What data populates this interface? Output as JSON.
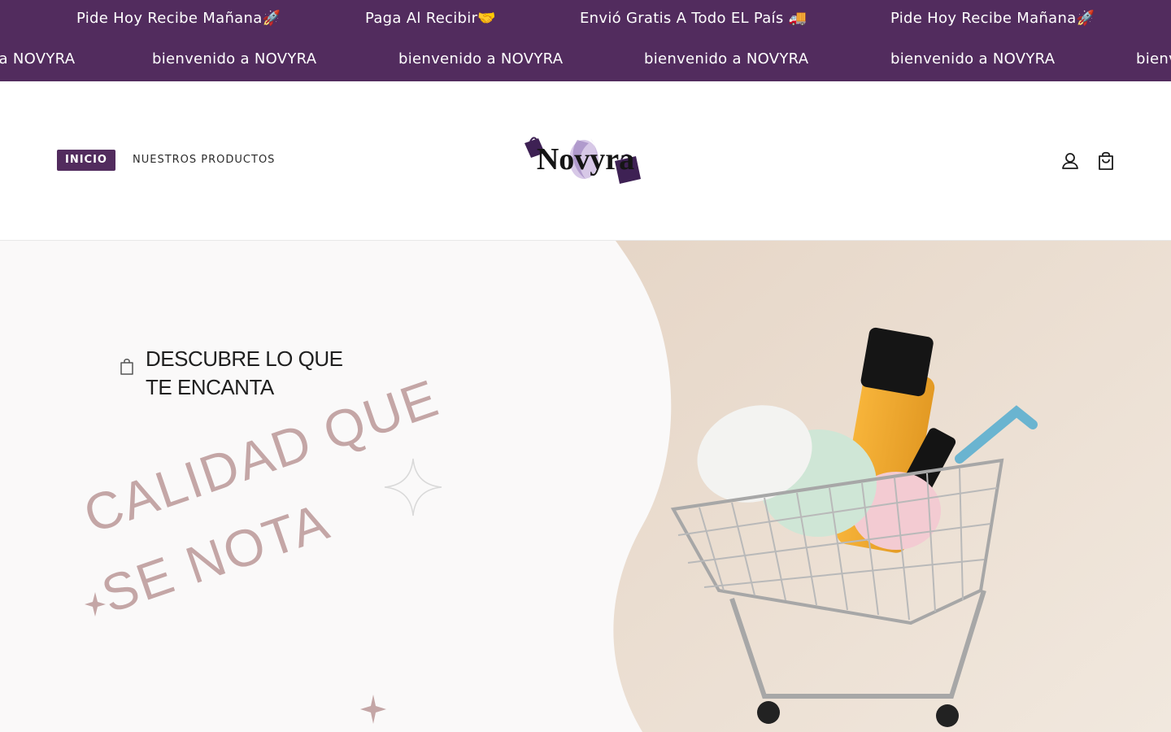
{
  "announcement_bar": {
    "row1": [
      "Pide Hoy Recibe Mañana🚀",
      "Paga Al Recibir🤝",
      "Envió Gratis A Todo EL País 🚚",
      "Pide Hoy Recibe Mañana🚀"
    ],
    "row2": [
      "bienvenido a NOVYRA",
      "bienvenido a NOVYRA",
      "bienvenido a NOVYRA",
      "bienvenido a NOVYRA",
      "bienvenido a NOVYRA",
      "bienvenido a NOVYRA"
    ],
    "background_color": "#522c5e"
  },
  "header": {
    "nav": {
      "home_label": "INICIO",
      "products_label": "NUESTROS PRODUCTOS"
    },
    "logo_text": "Novyra",
    "account_icon": "user-icon",
    "cart_icon": "shopping-bag-icon",
    "accent_color": "#522c5e"
  },
  "hero": {
    "tagline_line1": "DESCUBRE LO QUE",
    "tagline_line2": "TE ENCANTA",
    "slogan_line1": "CALIDAD QUE",
    "slogan_line2": "SE NOTA",
    "slogan_color": "#c4a6a6",
    "tagline_icon": "shopping-bag-icon",
    "image_subject": "shopping cart with cosmetic products"
  }
}
